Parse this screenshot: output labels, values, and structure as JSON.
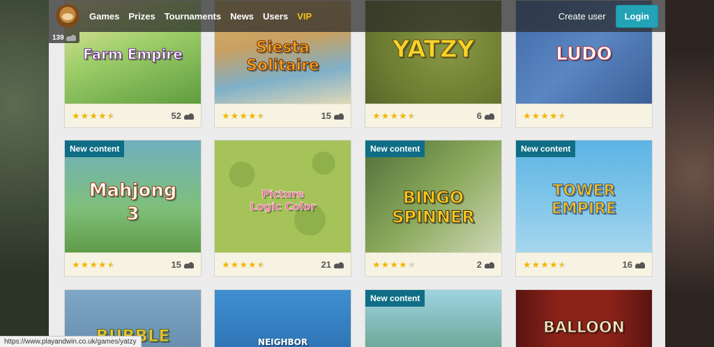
{
  "nav": {
    "links": [
      {
        "label": "Games"
      },
      {
        "label": "Prizes"
      },
      {
        "label": "Tournaments"
      },
      {
        "label": "News"
      },
      {
        "label": "Users"
      },
      {
        "label": "VIP"
      }
    ],
    "create_user": "Create user",
    "login": "Login"
  },
  "online_count": "139",
  "new_badge_label": "New content",
  "games": [
    {
      "title": "Farm Empire",
      "rating": 4.5,
      "players": "52",
      "new": false
    },
    {
      "title": "Siesta Solitaire",
      "rating": 4.5,
      "players": "15",
      "new": false
    },
    {
      "title": "Yatzy",
      "rating": 4.5,
      "players": "6",
      "new": false
    },
    {
      "title": "Ludo",
      "rating": 4.5,
      "players": "",
      "new": false
    },
    {
      "title": "Mahjong 3",
      "rating": 4.5,
      "players": "15",
      "new": true
    },
    {
      "title": "Picture Logic Color",
      "rating": 4.5,
      "players": "21",
      "new": false
    },
    {
      "title": "Bingo Spinner",
      "rating": 4,
      "players": "2",
      "new": true
    },
    {
      "title": "Tower Empire",
      "rating": 4.5,
      "players": "16",
      "new": true
    },
    {
      "title": "Bubble",
      "rating": null,
      "players": "",
      "new": false
    },
    {
      "title": "Neighbor",
      "rating": null,
      "players": "",
      "new": false
    },
    {
      "title": "",
      "rating": null,
      "players": "",
      "new": true
    },
    {
      "title": "Balloon",
      "rating": null,
      "players": "",
      "new": false
    }
  ],
  "status_url": "https://www.playandwin.co.uk/games/yatzy",
  "colors": {
    "accent": "#23a3b6",
    "vip": "#f3c21b",
    "badge": "#0f6e86",
    "star": "#f2b705"
  }
}
